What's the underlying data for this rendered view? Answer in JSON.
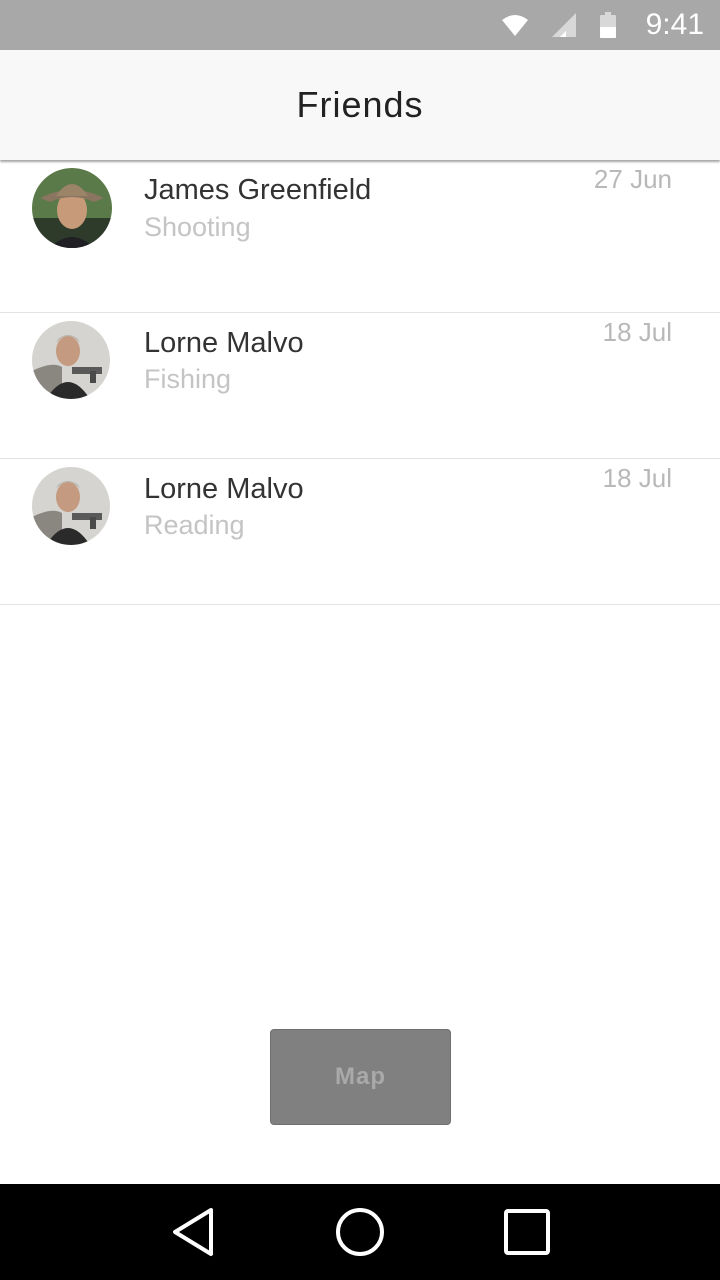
{
  "status_bar": {
    "time": "9:41",
    "icons": [
      "wifi-icon",
      "cellular-signal-icon",
      "battery-icon"
    ]
  },
  "header": {
    "title": "Friends"
  },
  "friends": [
    {
      "name": "James Greenfield",
      "activity": "Shooting",
      "date": "27 Jun",
      "avatar": "avatar-photo"
    },
    {
      "name": "Lorne Malvo",
      "activity": "Fishing",
      "date": "18 Jul",
      "avatar": "avatar-photo"
    },
    {
      "name": "Lorne Malvo",
      "activity": "Reading",
      "date": "18 Jul",
      "avatar": "avatar-photo"
    }
  ],
  "map_button": {
    "label": "Map"
  },
  "nav_bar": {
    "buttons": [
      "back-icon",
      "home-icon",
      "recents-icon"
    ]
  },
  "colors": {
    "status_bar_bg": "#a8a8a8",
    "app_bar_bg": "#f8f8f8",
    "button_bg": "#808080",
    "nav_bar_bg": "#000000"
  }
}
